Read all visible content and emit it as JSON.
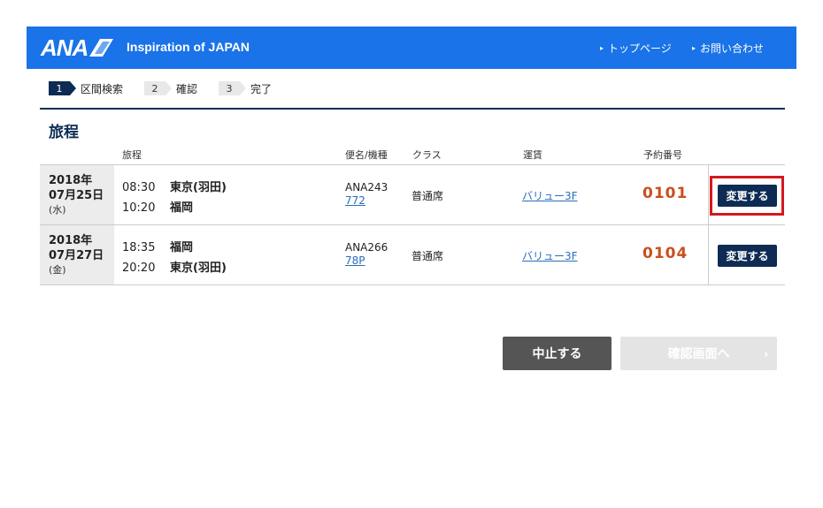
{
  "header": {
    "logo_text": "ANA",
    "tagline": "Inspiration of JAPAN",
    "nav_top": "トップページ",
    "nav_contact": "お問い合わせ",
    "brand_color": "#1a73e8"
  },
  "steps": [
    {
      "num": "1",
      "label": "区間検索",
      "active": true
    },
    {
      "num": "2",
      "label": "確認",
      "active": false
    },
    {
      "num": "3",
      "label": "完了",
      "active": false
    }
  ],
  "section_title": "旅程",
  "columns": {
    "itinerary": "旅程",
    "flight": "便名/機種",
    "class": "クラス",
    "fare": "運賃",
    "reservation": "予約番号"
  },
  "rows": [
    {
      "year": "2018年",
      "month_day": "07月25日",
      "weekday": "(水)",
      "dep_time": "08:30",
      "dep_airport": "東京(羽田)",
      "arr_time": "10:20",
      "arr_airport": "福岡",
      "flight_no": "ANA243",
      "equipment": "772",
      "class": "普通席",
      "fare": "バリュー3F",
      "reservation_no": "0101",
      "change_label": "変更する"
    },
    {
      "year": "2018年",
      "month_day": "07月27日",
      "weekday": "(金)",
      "dep_time": "18:35",
      "dep_airport": "福岡",
      "arr_time": "20:20",
      "arr_airport": "東京(羽田)",
      "flight_no": "ANA266",
      "equipment": "78P",
      "class": "普通席",
      "fare": "バリュー3F",
      "reservation_no": "0104",
      "change_label": "変更する"
    }
  ],
  "buttons": {
    "cancel": "中止する",
    "confirm": "確認画面へ"
  }
}
